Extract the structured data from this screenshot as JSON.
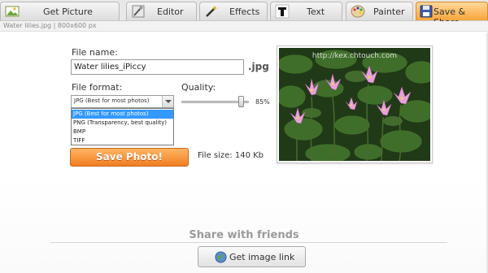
{
  "tabs": [
    {
      "label": "Get Picture",
      "icon": "photo-icon",
      "active": false
    },
    {
      "label": "Editor",
      "icon": "tools-icon",
      "active": false
    },
    {
      "label": "Effects",
      "icon": "wand-icon",
      "active": false
    },
    {
      "label": "Text",
      "icon": "text-t-icon",
      "active": false
    },
    {
      "label": "Painter",
      "icon": "palette-icon",
      "active": false
    },
    {
      "label": "Save & Share",
      "icon": "save-icon",
      "active": true
    }
  ],
  "file_info": "Water lilies.jpg | 800x600 px",
  "form": {
    "filename_label": "File name:",
    "filename_value": "Water lilies_iPiccy",
    "extension": ".jpg",
    "format_label": "File format:",
    "format_selected": "JPG (Best for most photos)",
    "format_options": [
      "JPG (Best for most photos)",
      "PNG (Transparency, best quality)",
      "BMP",
      "TIFF"
    ],
    "quality_label": "Quality:",
    "quality_value": "85%",
    "quality_fraction": 0.85,
    "save_button": "Save Photo!",
    "file_size": "File size: 140 Kb"
  },
  "preview": {
    "watermark": "http://kex.chtouch.com"
  },
  "share": {
    "title": "Share with friends",
    "link_button": "Get image link"
  },
  "colors": {
    "accent": "#f07d1f",
    "selection": "#3399ff"
  }
}
